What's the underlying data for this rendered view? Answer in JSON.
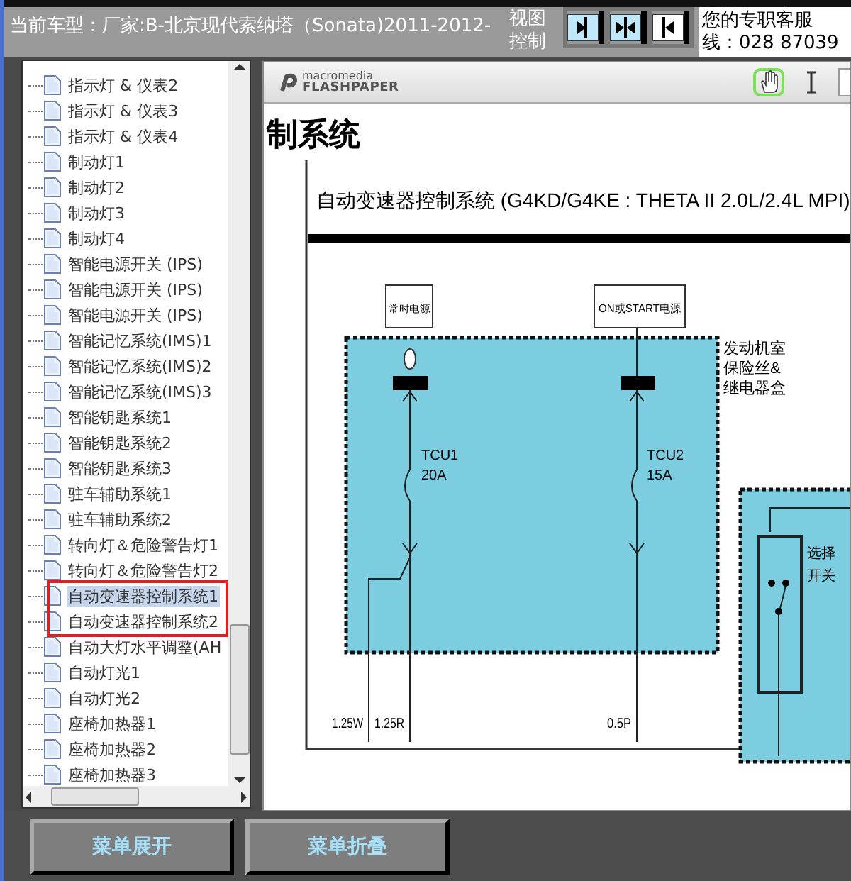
{
  "header": {
    "model": "当前车型：厂家:B-北京现代索纳塔（Sonata)2011-2012-",
    "view_control": "视图控制",
    "service": "您的专职客服",
    "phone": "线：028 87039"
  },
  "view_buttons": [
    {
      "kind": "right"
    },
    {
      "kind": "both"
    },
    {
      "kind": "left"
    }
  ],
  "tree": {
    "items": [
      {
        "label": "指示灯 & 仪表2",
        "selected": false,
        "annotated": false
      },
      {
        "label": "指示灯 & 仪表3",
        "selected": false,
        "annotated": false
      },
      {
        "label": "指示灯 & 仪表4",
        "selected": false,
        "annotated": false
      },
      {
        "label": "制动灯1",
        "selected": false,
        "annotated": false
      },
      {
        "label": "制动灯2",
        "selected": false,
        "annotated": false
      },
      {
        "label": "制动灯3",
        "selected": false,
        "annotated": false
      },
      {
        "label": "制动灯4",
        "selected": false,
        "annotated": false
      },
      {
        "label": "智能电源开关 (IPS)",
        "selected": false,
        "annotated": false
      },
      {
        "label": "智能电源开关 (IPS)",
        "selected": false,
        "annotated": false
      },
      {
        "label": "智能电源开关 (IPS)",
        "selected": false,
        "annotated": false
      },
      {
        "label": "智能记忆系统(IMS)1",
        "selected": false,
        "annotated": false
      },
      {
        "label": "智能记忆系统(IMS)2",
        "selected": false,
        "annotated": false
      },
      {
        "label": "智能记忆系统(IMS)3",
        "selected": false,
        "annotated": false
      },
      {
        "label": "智能钥匙系统1",
        "selected": false,
        "annotated": false
      },
      {
        "label": "智能钥匙系统2",
        "selected": false,
        "annotated": false
      },
      {
        "label": "智能钥匙系统3",
        "selected": false,
        "annotated": false
      },
      {
        "label": "驻车辅助系统1",
        "selected": false,
        "annotated": false
      },
      {
        "label": "驻车辅助系统2",
        "selected": false,
        "annotated": false
      },
      {
        "label": "转向灯＆危险警告灯1",
        "selected": false,
        "annotated": false
      },
      {
        "label": "转向灯＆危险警告灯2",
        "selected": false,
        "annotated": false
      },
      {
        "label": "自动变速器控制系统1",
        "selected": true,
        "annotated": true
      },
      {
        "label": "自动变速器控制系统2",
        "selected": false,
        "annotated": true
      },
      {
        "label": "自动大灯水平调整(AH",
        "selected": false,
        "annotated": false
      },
      {
        "label": "自动灯光1",
        "selected": false,
        "annotated": false
      },
      {
        "label": "自动灯光2",
        "selected": false,
        "annotated": false
      },
      {
        "label": "座椅加热器1",
        "selected": false,
        "annotated": false
      },
      {
        "label": "座椅加热器2",
        "selected": false,
        "annotated": false
      },
      {
        "label": "座椅加热器3",
        "selected": false,
        "annotated": false
      }
    ]
  },
  "viewer": {
    "logo_top": "macromedia",
    "logo_bottom": "FLASHPAPER",
    "tools": [
      {
        "kind": "hand",
        "selected": true
      },
      {
        "kind": "text",
        "selected": false
      }
    ],
    "page_heading": "制系统",
    "diagram": {
      "title": "自动变速器控制系统 (G4KD/G4KE : THETA II 2.0L/2.4L MPI)",
      "power_1": "常时电源",
      "power_2": "ON或START电源",
      "fuse_box": [
        "发动机室",
        "保险丝&",
        "继电器盒"
      ],
      "fuse_1": [
        "TCU1",
        "20A"
      ],
      "fuse_2": [
        "TCU2",
        "15A"
      ],
      "switch": [
        "选择",
        "开关"
      ],
      "wires": [
        "1.25W",
        "1.25R",
        "0.5P"
      ]
    }
  },
  "buttons": [
    "菜单展开",
    "菜单折叠"
  ]
}
